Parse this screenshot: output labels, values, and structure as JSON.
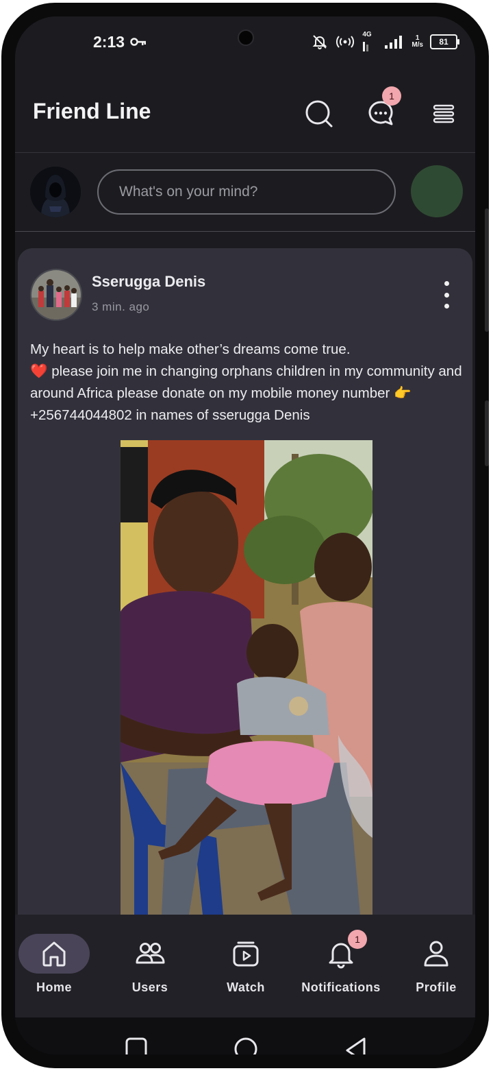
{
  "status_bar": {
    "time": "2:13",
    "network": "4G",
    "speed_value": "1",
    "speed_unit": "M/s",
    "battery": "81"
  },
  "header": {
    "title": "Friend Line",
    "messages_badge": "1"
  },
  "composer": {
    "placeholder": "What's on your mind?"
  },
  "post": {
    "author": "Sserugga Denis",
    "time": "3 min. ago",
    "text_line1": "My heart is to help make other’s dreams come true.",
    "text_line2": "❤️ please join me in changing orphans children in my community and around Africa please donate on my mobile money number 👉 +256744044802 in names of sserugga Denis"
  },
  "bottom_nav": {
    "items": [
      {
        "label": "Home",
        "icon": "home-icon",
        "active": true
      },
      {
        "label": "Users",
        "icon": "users-icon",
        "active": false
      },
      {
        "label": "Watch",
        "icon": "watch-icon",
        "active": false
      },
      {
        "label": "Notifications",
        "icon": "bell-icon",
        "active": false,
        "badge": "1"
      },
      {
        "label": "Profile",
        "icon": "profile-icon",
        "active": false
      }
    ]
  },
  "colors": {
    "background": "#1c1c20",
    "card": "#32313b",
    "nav_active_pill": "#4a4458",
    "badge": "#f2a6ad",
    "composer_action": "#2f4a33"
  }
}
